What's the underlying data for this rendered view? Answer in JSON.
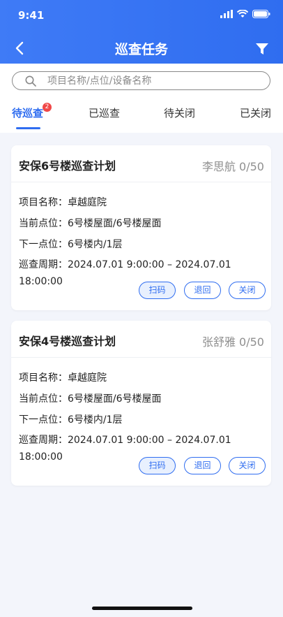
{
  "status_bar": {
    "time": "9:41"
  },
  "header": {
    "title": "巡查任务"
  },
  "search": {
    "placeholder": "项目名称/点位/设备名称"
  },
  "tabs": [
    {
      "label": "待巡查",
      "badge": "2",
      "active": true
    },
    {
      "label": "已巡查"
    },
    {
      "label": "待关闭"
    },
    {
      "label": "已关闭"
    }
  ],
  "tasks": [
    {
      "title": "安保6号楼巡查计划",
      "meta": "李思航 0/50",
      "project": "项目名称：卓越庭院",
      "current": "当前点位：6号楼屋面/6号楼屋面",
      "next": "下一点位：6号楼内/1层",
      "period_line1": "巡查周期：2024.07.01 9:00:00 – 2024.07.01",
      "period_line2": "18:00:00",
      "buttons": [
        "扫码",
        "退回",
        "关闭"
      ]
    },
    {
      "title": "安保4号楼巡查计划",
      "meta": "张舒雅 0/50",
      "project": "项目名称：卓越庭院",
      "current": "当前点位：6号楼屋面/6号楼屋面",
      "next": "下一点位：6号楼内/1层",
      "period_line1": "巡查周期：2024.07.01 9:00:00 – 2024.07.01",
      "period_line2": "18:00:00",
      "buttons": [
        "扫码",
        "退回",
        "关闭"
      ]
    }
  ],
  "colors": {
    "primary": "#2f6df0",
    "badge": "#f04848",
    "background": "#f3f5fb"
  },
  "icons": [
    "back-chevron-icon",
    "filter-funnel-icon",
    "search-icon",
    "signal-icon",
    "wifi-icon",
    "battery-icon"
  ]
}
